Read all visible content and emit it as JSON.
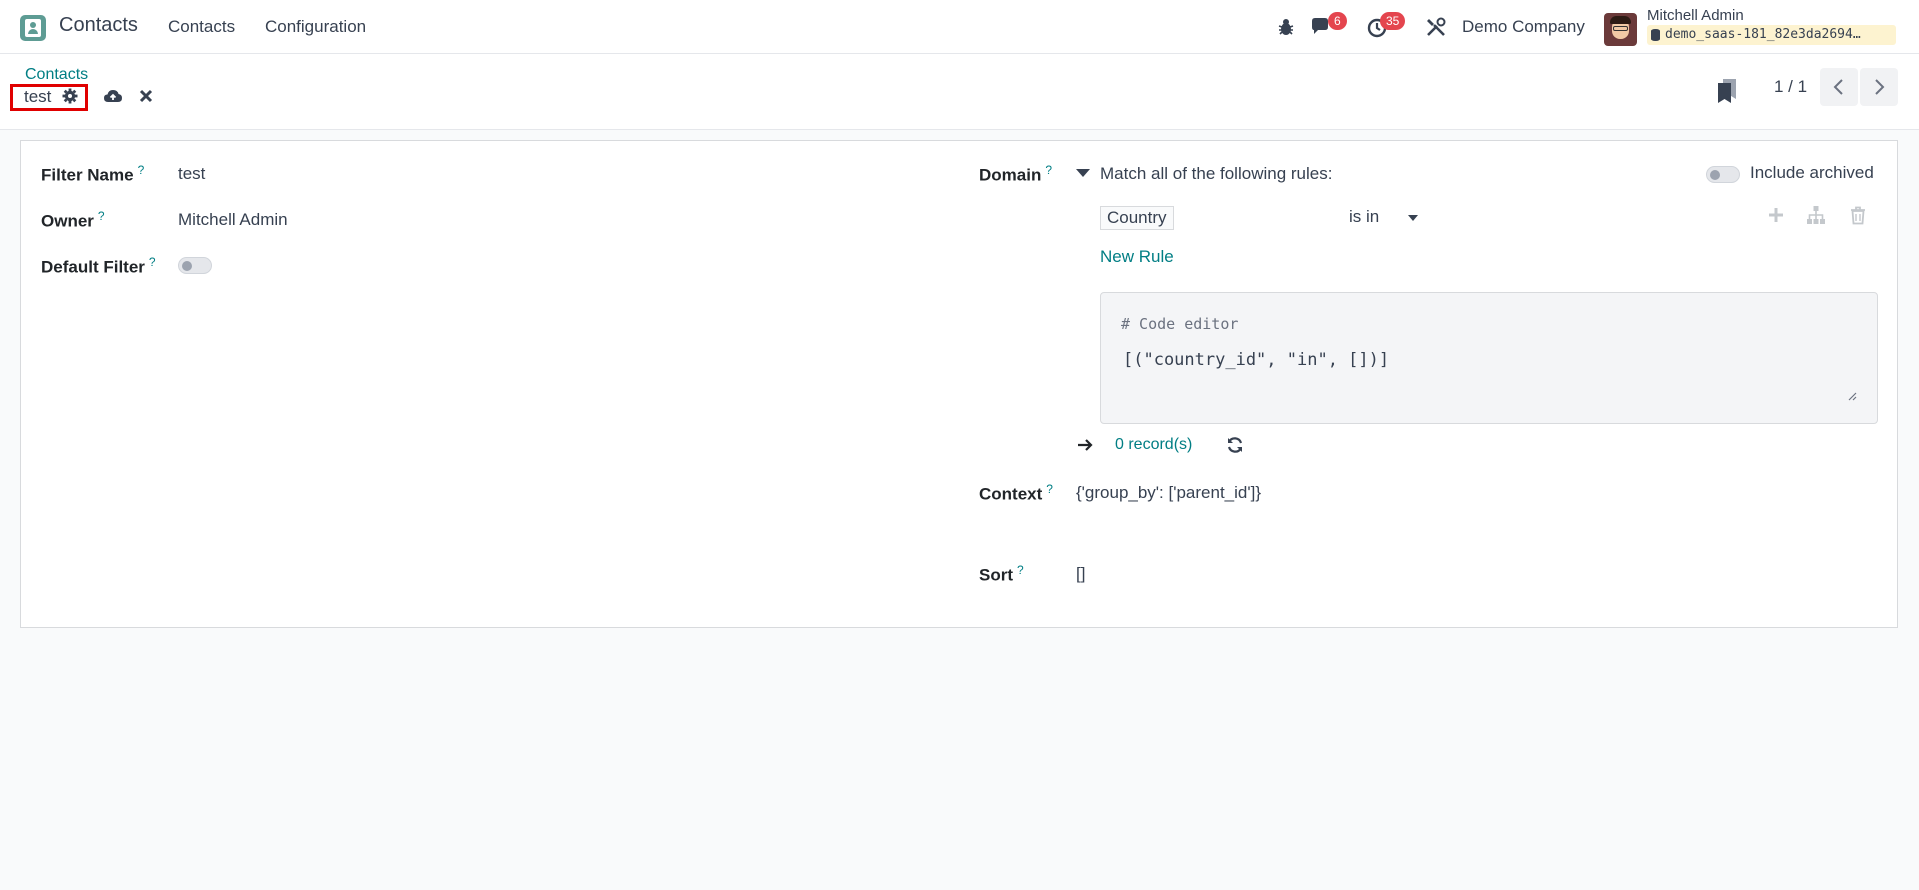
{
  "navbar": {
    "app_name": "Contacts",
    "menu": [
      "Contacts",
      "Configuration"
    ],
    "messages_badge": "6",
    "activities_badge": "35",
    "company": "Demo Company",
    "user_name": "Mitchell Admin",
    "database": "demo_saas-181_82e3da2694…"
  },
  "control_panel": {
    "breadcrumb": "Contacts",
    "record_title": "test",
    "pager": "1 / 1"
  },
  "form": {
    "filter_name_label": "Filter Name",
    "filter_name_value": "test",
    "owner_label": "Owner",
    "owner_value": "Mitchell Admin",
    "default_filter_label": "Default Filter",
    "default_filter_on": false,
    "help_mark": "?",
    "domain_label": "Domain",
    "match_text": "Match all of the following rules:",
    "include_archived_label": "Include archived",
    "include_archived_on": false,
    "rule_field": "Country",
    "rule_operator": "is in",
    "new_rule_label": "New Rule",
    "code_comment": "# Code editor",
    "code_value": "[(\"country_id\", \"in\", [])]",
    "records_count": "0 record(s)",
    "context_label": "Context",
    "context_value": "{'group_by': ['parent_id']}",
    "sort_label": "Sort",
    "sort_value": "[]"
  },
  "colors": {
    "accent": "#017e84",
    "badge": "#e4454e",
    "highlight_box": "#e00000"
  },
  "icons": [
    "contacts-app-icon",
    "bug-icon",
    "chat-icon",
    "clock-icon",
    "tools-icon",
    "database-icon",
    "gear-icon",
    "cloud-upload-icon",
    "close-icon",
    "bookmark-icon",
    "chevron-left-icon",
    "chevron-right-icon",
    "caret-down-icon",
    "plus-icon",
    "sitemap-icon",
    "trash-icon",
    "arrow-right-icon",
    "refresh-icon"
  ]
}
